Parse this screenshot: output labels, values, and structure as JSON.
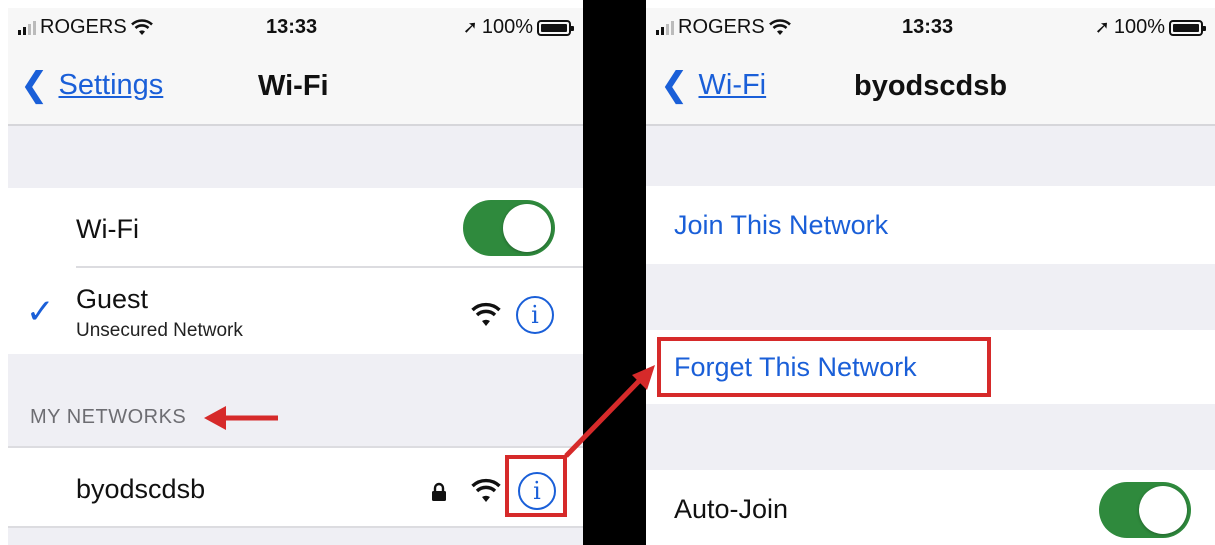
{
  "left_screen": {
    "status": {
      "carrier": "ROGERS",
      "time": "13:33",
      "battery": "100%"
    },
    "nav": {
      "back_label": "Settings",
      "title": "Wi-Fi"
    },
    "wifi_row": {
      "label": "Wi-Fi",
      "toggle_on": true
    },
    "connected_network": {
      "name": "Guest",
      "subtitle": "Unsecured Network",
      "checked": true
    },
    "section_header": "MY NETWORKS",
    "saved_network": {
      "name": "byodscdsb",
      "locked": true
    }
  },
  "right_screen": {
    "status": {
      "carrier": "ROGERS",
      "time": "13:33",
      "battery": "100%"
    },
    "nav": {
      "back_label": "Wi-Fi",
      "title": "byodscdsb"
    },
    "join_label": "Join This Network",
    "forget_label": "Forget This Network",
    "auto_join": {
      "label": "Auto-Join",
      "toggle_on": true
    }
  },
  "colors": {
    "ios_blue": "#1a5fd8",
    "toggle_green": "#2f8a3d",
    "annotation_red": "#d62a2a",
    "group_background": "#efeff4"
  },
  "icons": [
    "chevron-left-icon",
    "wifi-icon",
    "info-icon",
    "lock-icon",
    "checkmark-icon",
    "location-arrow-icon",
    "battery-icon",
    "signal-bars-icon"
  ]
}
